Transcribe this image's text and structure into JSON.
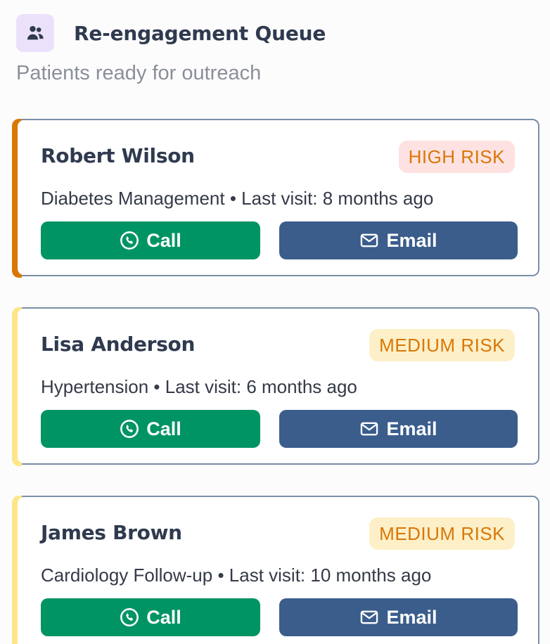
{
  "header": {
    "title": "Re-engagement Queue",
    "subtitle": "Patients ready for outreach",
    "icon": "users-icon"
  },
  "colors": {
    "call_button": "#009464",
    "email_button": "#3b5d8c",
    "high_risk_accent": "#d97706",
    "medium_risk_accent": "#fde68a"
  },
  "patients": [
    {
      "name": "Robert Wilson",
      "risk": "HIGH RISK",
      "detail": "Diabetes Management • Last visit: 8 months ago",
      "call_label": "Call",
      "email_label": "Email"
    },
    {
      "name": "Lisa Anderson",
      "risk": "MEDIUM RISK",
      "detail": "Hypertension • Last visit: 6 months ago",
      "call_label": "Call",
      "email_label": "Email"
    },
    {
      "name": "James Brown",
      "risk": "MEDIUM RISK",
      "detail": "Cardiology Follow-up • Last visit: 10 months ago",
      "call_label": "Call",
      "email_label": "Email"
    }
  ]
}
